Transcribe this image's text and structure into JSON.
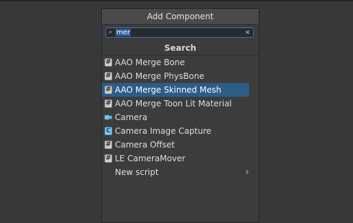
{
  "window": {
    "panel_title": "Add Component"
  },
  "search": {
    "value": "mer",
    "section_title": "Search"
  },
  "icons": {
    "search": "search-icon",
    "clear": "close-icon",
    "script": "hash-script-icon",
    "camera": "camera-icon",
    "capture": "camera-capture-icon",
    "submenu": "chevron-right-icon"
  },
  "colors": {
    "selection": "#2c5d87",
    "focus": "#3a79bb",
    "camera": "#6fc2f2"
  },
  "list": {
    "items": [
      {
        "label": "AAO Merge Bone"
      },
      {
        "label": "AAO Merge PhysBone"
      },
      {
        "label": "AAO Merge Skinned Mesh"
      },
      {
        "label": "AAO Merge Toon Lit Material"
      },
      {
        "label": "Camera"
      },
      {
        "label": "Camera Image Capture"
      },
      {
        "label": "Camera Offset"
      },
      {
        "label": "LE CameraMover"
      },
      {
        "label": "New script"
      }
    ]
  }
}
